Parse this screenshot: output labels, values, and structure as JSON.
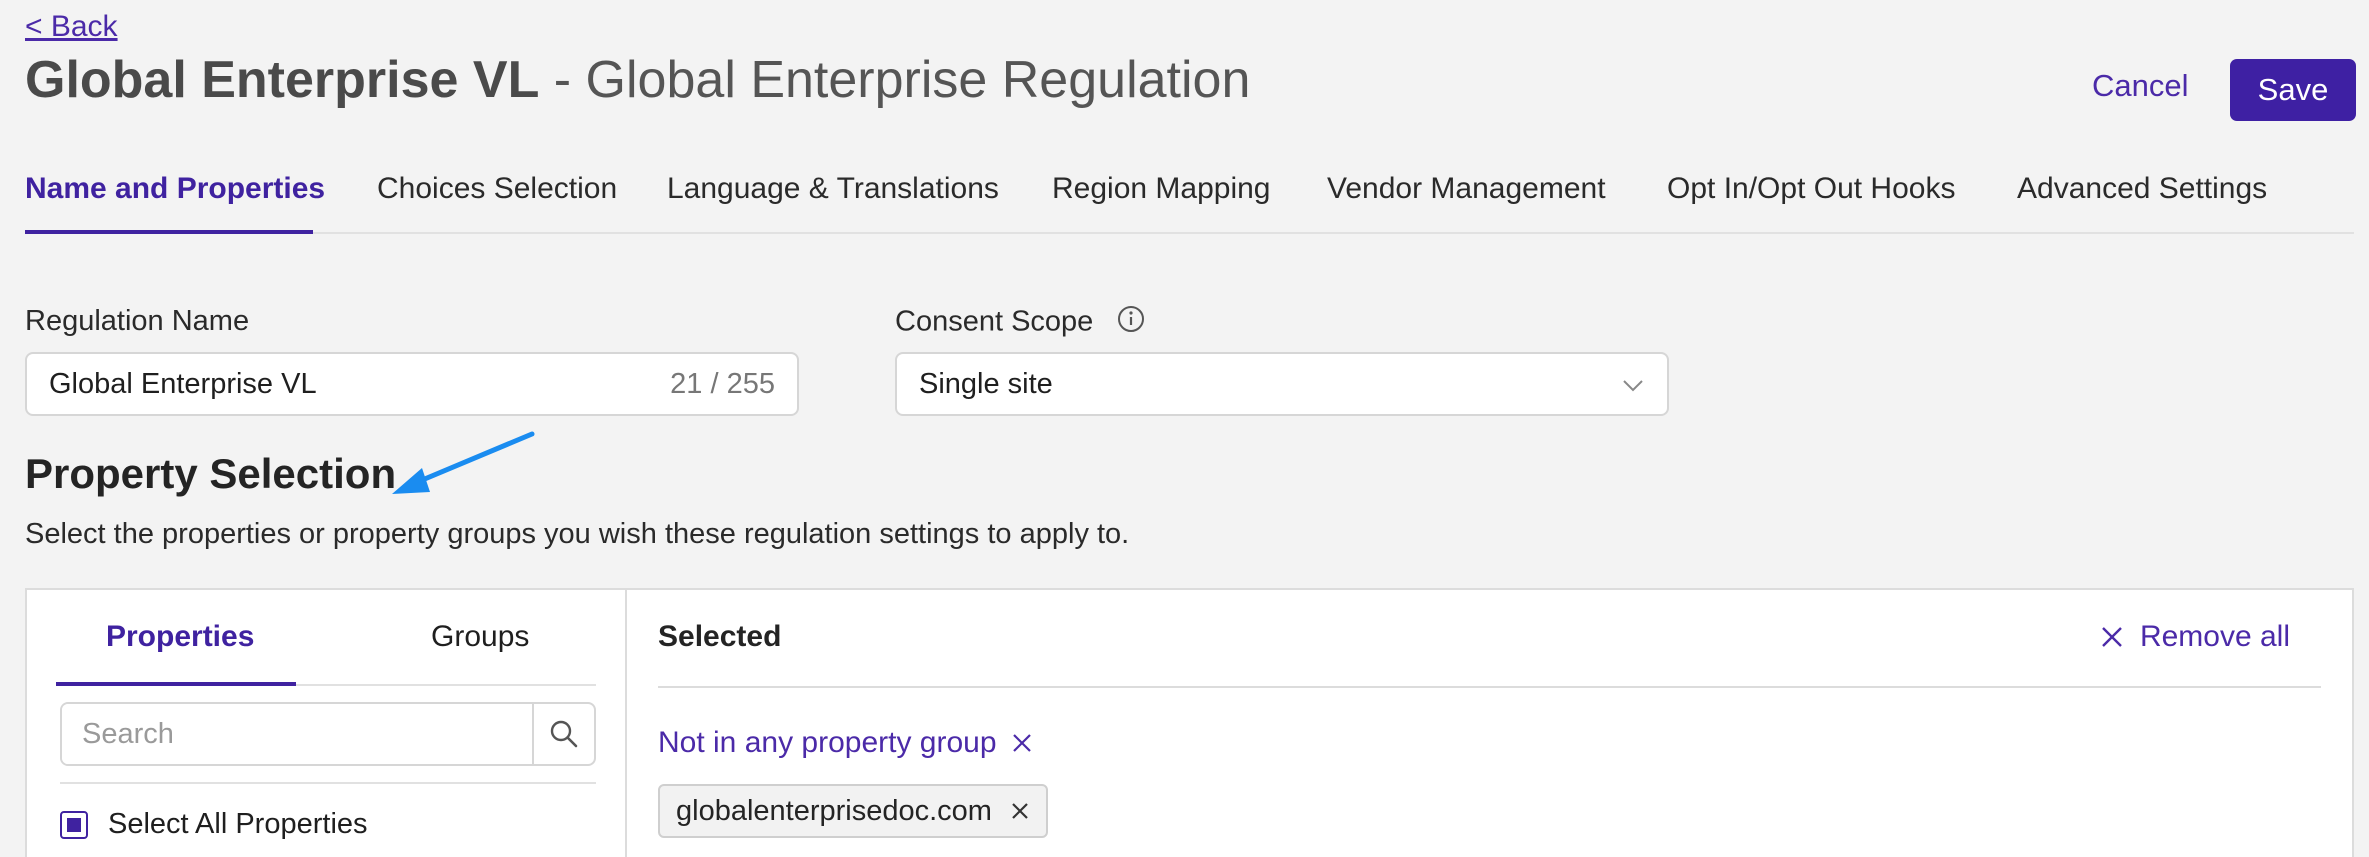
{
  "header": {
    "back_label": "< Back",
    "title_bold": "Global Enterprise VL",
    "title_rest": " - Global Enterprise Regulation",
    "cancel_label": "Cancel",
    "save_label": "Save"
  },
  "tabs": [
    {
      "label": "Name and Properties",
      "active": true
    },
    {
      "label": "Choices Selection"
    },
    {
      "label": "Language & Translations"
    },
    {
      "label": "Region Mapping"
    },
    {
      "label": "Vendor Management"
    },
    {
      "label": "Opt In/Opt Out Hooks"
    },
    {
      "label": "Advanced Settings"
    }
  ],
  "form": {
    "regulation_name_label": "Regulation Name",
    "regulation_name_value": "Global Enterprise VL",
    "regulation_name_counter": "21 / 255",
    "consent_scope_label": "Consent Scope",
    "consent_scope_value": "Single site"
  },
  "property_selection": {
    "title": "Property Selection",
    "description": "Select the properties or property groups you wish these regulation settings to apply to.",
    "tabs": [
      "Properties",
      "Groups"
    ],
    "search_placeholder": "Search",
    "select_all_label": "Select All Properties",
    "selected_label": "Selected",
    "remove_all_label": "Remove all",
    "group_label": "Not in any property group",
    "chips": [
      "globalenterprisedoc.com"
    ]
  },
  "colors": {
    "accent": "#3f22a0",
    "annotation_arrow": "#1a8cf0"
  },
  "icons": [
    "info-icon",
    "chevron-down-icon",
    "search-icon",
    "close-icon",
    "arrow-annotation-icon"
  ]
}
